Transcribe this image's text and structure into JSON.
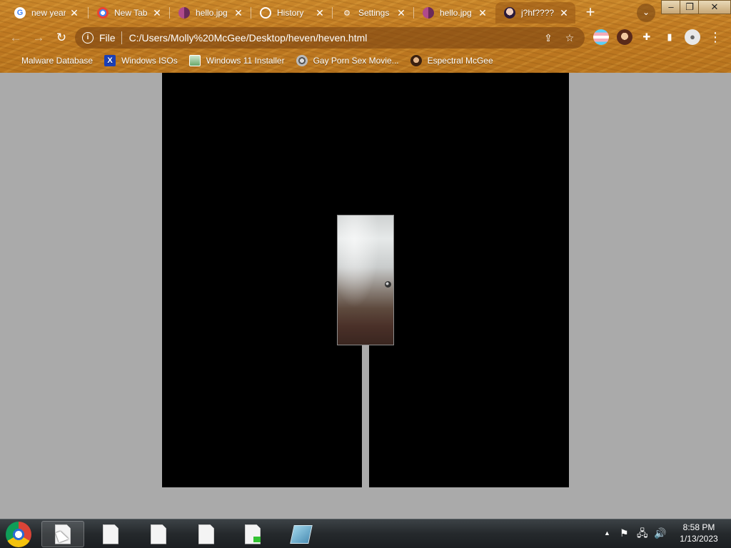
{
  "browser": {
    "tabs": [
      {
        "label": "new year",
        "favicon": "google-icon",
        "glyph": "G"
      },
      {
        "label": "New Tab",
        "favicon": "chrome-icon",
        "glyph": ""
      },
      {
        "label": "hello.jpg",
        "favicon": "image-icon",
        "glyph": ""
      },
      {
        "label": "History",
        "favicon": "history-icon",
        "glyph": ""
      },
      {
        "label": "Settings",
        "favicon": "gear-icon",
        "glyph": "⚙"
      },
      {
        "label": "hello.jpg",
        "favicon": "image-icon",
        "glyph": ""
      },
      {
        "label": "j?hf????",
        "favicon": "anime-icon",
        "glyph": ""
      }
    ],
    "active_tab_index": 6,
    "close_glyph": "✕",
    "new_tab_glyph": "+",
    "tab_search_glyph": "⌄",
    "window_controls": {
      "minimize": "–",
      "maximize": "❐",
      "close": "✕"
    },
    "nav": {
      "back": "←",
      "forward": "→",
      "reload": "↻"
    },
    "omnibox": {
      "info_glyph": "i",
      "scheme": "File",
      "url": "C:/Users/Molly%20McGee/Desktop/heven/heven.html",
      "share_glyph": "⇪",
      "star_glyph": "☆"
    },
    "extensions": {
      "puzzle_glyph": "✚",
      "sidepanel_glyph": "▮",
      "profile_glyph": "●",
      "menu_glyph": "⋮"
    },
    "bookmarks": [
      {
        "label": "Malware Database",
        "icon": "blank"
      },
      {
        "label": "Windows ISOs",
        "icon": "x-icon",
        "glyph": "X"
      },
      {
        "label": "Windows 11 Installer",
        "icon": "image-icon"
      },
      {
        "label": "Gay Porn Sex Movie...",
        "icon": "disc-icon"
      },
      {
        "label": "Espectral McGee",
        "icon": "face-icon"
      }
    ],
    "theme_color": "#c07a22"
  },
  "page": {
    "background_color": "#aaaaaa",
    "stage_color": "#000000"
  },
  "taskbar": {
    "items": [
      "chrome-icon",
      "document-icon",
      "document-icon",
      "document-icon",
      "document-icon",
      "document-green-icon",
      "notepad-icon"
    ],
    "tray": {
      "show_hidden": "▲",
      "flag": "⚑",
      "network": "🖧",
      "volume": "🔊"
    },
    "clock": {
      "time": "8:58 PM",
      "date": "1/13/2023"
    }
  }
}
